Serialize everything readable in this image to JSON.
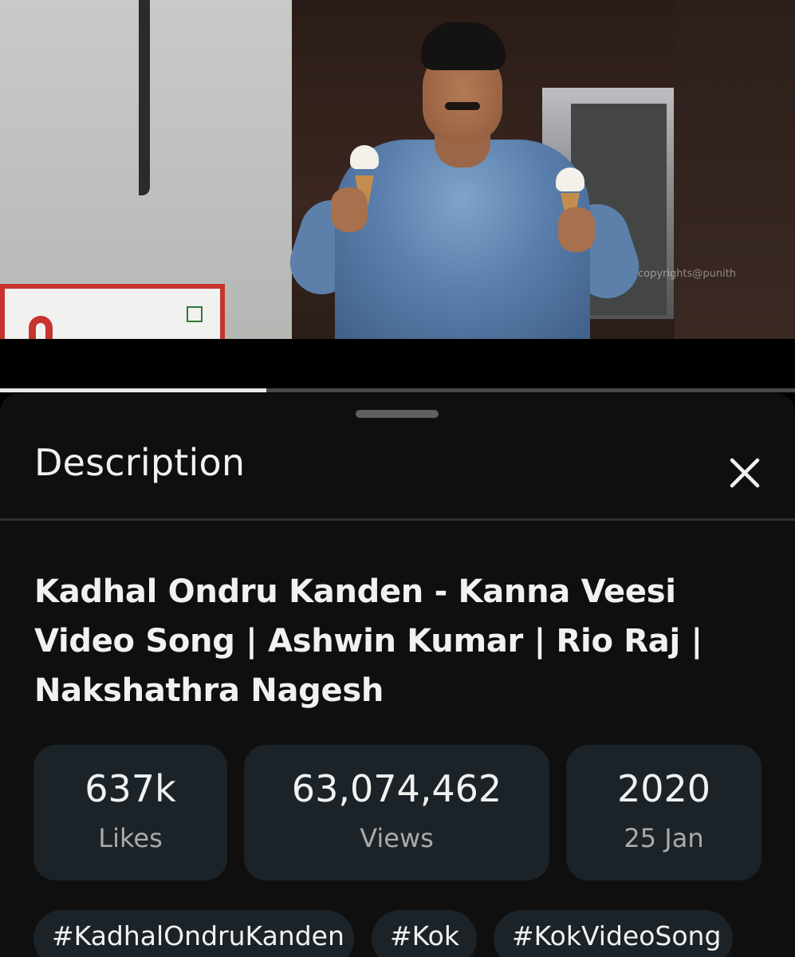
{
  "video": {
    "watermark": "copyrights@punith",
    "progress_fraction": 0.335
  },
  "sheet": {
    "title": "Description",
    "close_icon": "close-icon"
  },
  "details": {
    "video_title": "Kadhal Ondru Kanden - Kanna Veesi Video Song | Ashwin Kumar | Rio Raj | Nakshathra Nagesh",
    "stats": {
      "likes_value": "637k",
      "likes_label": "Likes",
      "views_value": "63,074,462",
      "views_label": "Views",
      "year": "2020",
      "date": "25 Jan"
    },
    "hashtags": [
      "#KadhalOndruKanden",
      "#Kok",
      "#KokVideoSong"
    ]
  },
  "colors": {
    "sheet_bg": "#0f0f0f",
    "card_bg": "#1b2329",
    "text_primary": "#f1f1f1",
    "text_secondary": "#aaaaaa"
  }
}
